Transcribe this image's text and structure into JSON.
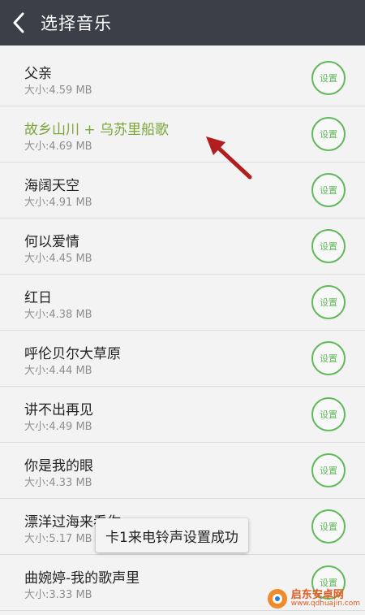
{
  "header": {
    "title": "选择音乐",
    "back_icon": "chevron-left-icon"
  },
  "songs": [
    {
      "name": "父亲",
      "size": "大小:4.59 MB",
      "set_label": "设置"
    },
    {
      "name": "故乡山川 + 乌苏里船歌",
      "size": "大小:4.69 MB",
      "set_label": "设置",
      "highlighted": true
    },
    {
      "name": "海阔天空",
      "size": "大小:4.91 MB",
      "set_label": "设置"
    },
    {
      "name": "何以爱情",
      "size": "大小:4.45 MB",
      "set_label": "设置"
    },
    {
      "name": "红日",
      "size": "大小:4.38 MB",
      "set_label": "设置"
    },
    {
      "name": "呼伦贝尔大草原",
      "size": "大小:4.44 MB",
      "set_label": "设置"
    },
    {
      "name": "讲不出再见",
      "size": "大小:4.49 MB",
      "set_label": "设置"
    },
    {
      "name": "你是我的眼",
      "size": "大小:4.33 MB",
      "set_label": "设置"
    },
    {
      "name": "漂洋过海来看你",
      "size": "大小:5.17 MB",
      "set_label": "设置"
    },
    {
      "name": "曲婉婷-我的歌声里",
      "size": "大小:3.33 MB",
      "set_label": "设置"
    }
  ],
  "toast": {
    "text": "卡1来电铃声设置成功"
  },
  "watermark": {
    "name": "启东安卓网",
    "url": "www.qdhuajin.com"
  },
  "colors": {
    "header_bg": "#3b3f48",
    "accent_green": "#62b85a",
    "highlight_text": "#7aa63a",
    "arrow": "#b01e1e"
  }
}
